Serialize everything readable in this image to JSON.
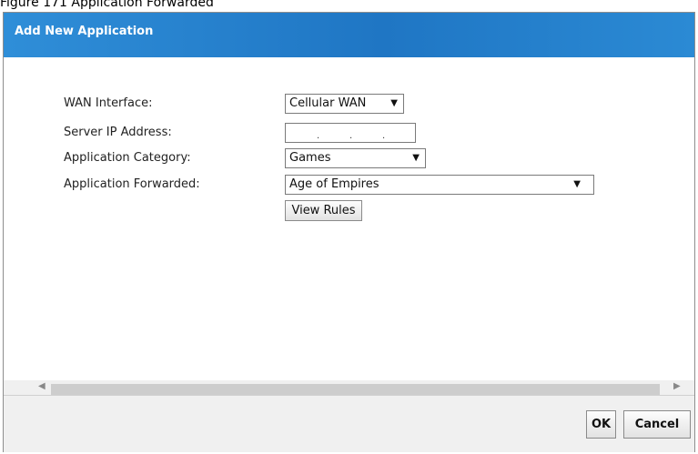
{
  "caption": "Figure 171 Application Forwarded",
  "dialog": {
    "title": "Add New Application"
  },
  "form": {
    "wan_interface": {
      "label": "WAN Interface:",
      "value": "Cellular WAN"
    },
    "server_ip": {
      "label": "Server IP Address:",
      "value": ". . ."
    },
    "app_category": {
      "label": "Application Category:",
      "value": "Games"
    },
    "app_forwarded": {
      "label": "Application Forwarded:",
      "value": "Age of Empires"
    },
    "view_rules_label": "View Rules"
  },
  "footer": {
    "ok_label": "OK",
    "cancel_label": "Cancel"
  },
  "icons": {
    "dropdown": "chevron-down-icon",
    "scroll_left": "arrow-left-icon",
    "scroll_right": "arrow-right-icon"
  }
}
